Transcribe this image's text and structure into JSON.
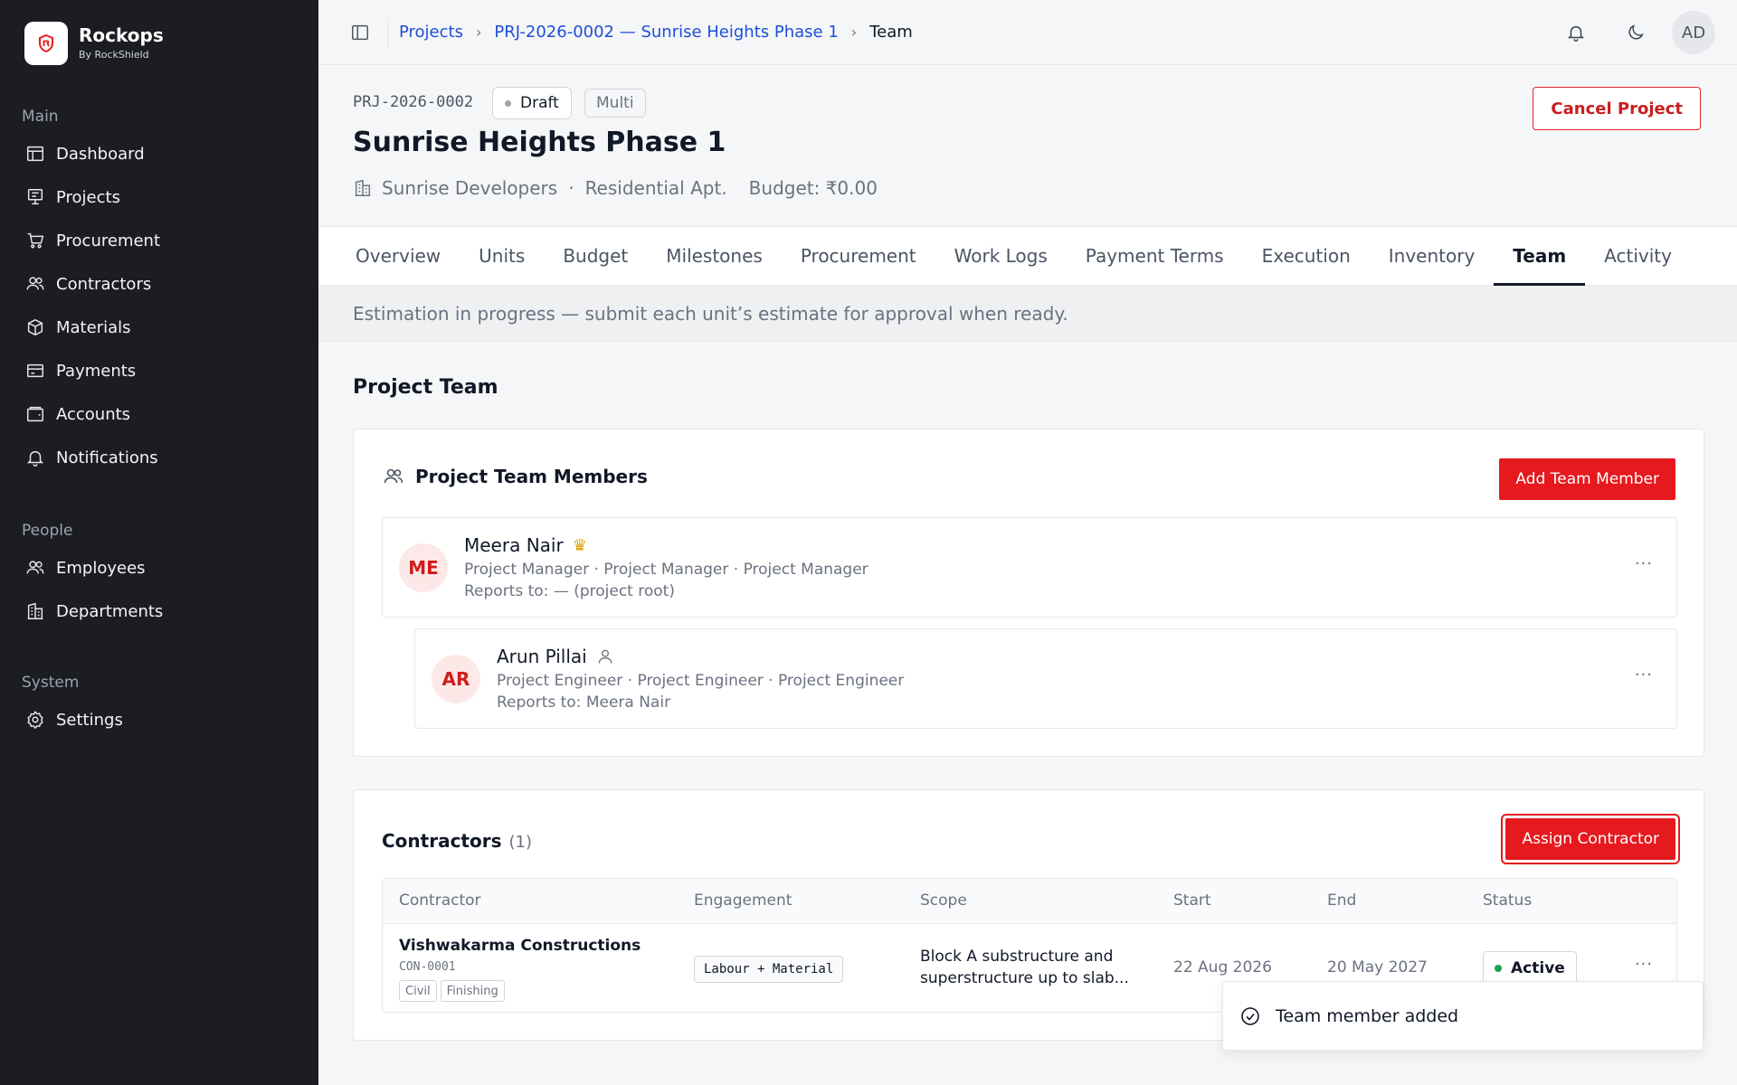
{
  "brand": {
    "name": "Rockops",
    "sub": "By RockShield"
  },
  "sidebar": {
    "sections": [
      {
        "heading": "Main",
        "items": [
          {
            "label": "Dashboard",
            "icon": "dashboard-icon"
          },
          {
            "label": "Projects",
            "icon": "projects-icon"
          },
          {
            "label": "Procurement",
            "icon": "cart-icon"
          },
          {
            "label": "Contractors",
            "icon": "users-icon"
          },
          {
            "label": "Materials",
            "icon": "box-icon"
          },
          {
            "label": "Payments",
            "icon": "card-icon"
          },
          {
            "label": "Accounts",
            "icon": "wallet-icon"
          },
          {
            "label": "Notifications",
            "icon": "bell-icon"
          }
        ]
      },
      {
        "heading": "People",
        "items": [
          {
            "label": "Employees",
            "icon": "users-icon"
          },
          {
            "label": "Departments",
            "icon": "building-icon"
          }
        ]
      },
      {
        "heading": "System",
        "items": [
          {
            "label": "Settings",
            "icon": "gear-icon"
          }
        ]
      }
    ]
  },
  "topbar": {
    "breadcrumb": [
      "Projects",
      "PRJ-2026-0002 — Sunrise Heights Phase 1",
      "Team"
    ],
    "avatar": "AD"
  },
  "project": {
    "code": "PRJ-2026-0002",
    "status": "Draft",
    "type": "Multi",
    "title": "Sunrise Heights Phase 1",
    "developer": "Sunrise Developers",
    "category": "Residential Apt.",
    "budget": "Budget: ₹0.00",
    "cancel_label": "Cancel Project"
  },
  "tabs": [
    "Overview",
    "Units",
    "Budget",
    "Milestones",
    "Procurement",
    "Work Logs",
    "Payment Terms",
    "Execution",
    "Inventory",
    "Team",
    "Activity"
  ],
  "active_tab": "Team",
  "notice": "Estimation in progress — submit each unit’s estimate for approval when ready.",
  "team_section": {
    "title": "Project Team",
    "card_title": "Project Team Members",
    "add_label": "Add Team Member",
    "members": [
      {
        "initials": "ME",
        "name": "Meera Nair",
        "roles": "Project Manager · Project Manager · Project Manager",
        "reports": "Reports to: — (project root)"
      },
      {
        "initials": "AR",
        "name": "Arun Pillai",
        "roles": "Project Engineer · Project Engineer · Project Engineer",
        "reports": "Reports to: Meera Nair"
      }
    ]
  },
  "contractors": {
    "title": "Contractors",
    "count": "(1)",
    "assign_label": "Assign Contractor",
    "columns": [
      "Contractor",
      "Engagement",
      "Scope",
      "Start",
      "End",
      "Status"
    ],
    "rows": [
      {
        "name": "Vishwakarma Constructions",
        "code": "CON-0001",
        "tags": [
          "Civil",
          "Finishing"
        ],
        "engagement": "Labour + Material",
        "scope": "Block A substructure and superstructure up to slab...",
        "start": "22 Aug 2026",
        "end": "20 May 2027",
        "status": "Active"
      }
    ]
  },
  "toast": {
    "message": "Team member added"
  },
  "colors": {
    "accent": "#e5191e",
    "sidebar_bg": "#1b1d22",
    "link": "#1d4ed8",
    "status_active": "#16a34a"
  }
}
